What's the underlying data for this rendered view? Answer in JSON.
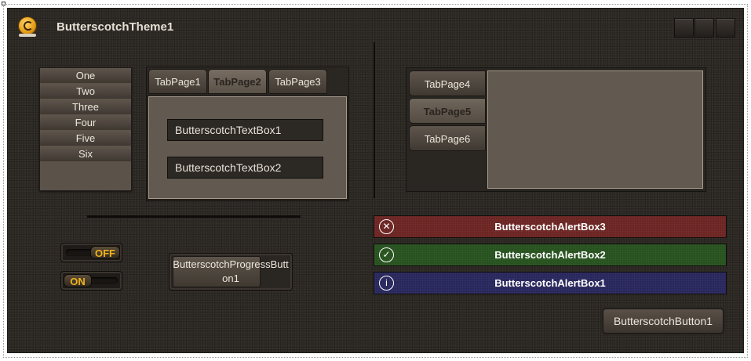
{
  "form": {
    "title": "ButterscotchTheme1"
  },
  "listbox": {
    "items": [
      "One",
      "Two",
      "Three",
      "Four",
      "Five",
      "Six"
    ]
  },
  "tabs1": {
    "tabs": [
      "TabPage1",
      "TabPage2",
      "TabPage3"
    ],
    "active": "TabPage2",
    "textboxes": [
      "ButterscotchTextBox1",
      "ButterscotchTextBox2"
    ]
  },
  "tabs2": {
    "tabs": [
      "TabPage4",
      "TabPage5",
      "TabPage6"
    ],
    "active": "TabPage5"
  },
  "toggles": {
    "off_label": "OFF",
    "on_label": "ON"
  },
  "progress_button": {
    "label": "ButterscotchProgressButton1"
  },
  "alerts": [
    {
      "label": "ButterscotchAlertBox3",
      "icon": "x-circle-icon",
      "color": "#6b2523"
    },
    {
      "label": "ButterscotchAlertBox2",
      "icon": "check-circle-icon",
      "color": "#27521f"
    },
    {
      "label": "ButterscotchAlertBox1",
      "icon": "info-circle-icon",
      "color": "#28275c"
    }
  ],
  "button": {
    "label": "ButterscotchButton1"
  },
  "colors": {
    "accent": "#f2b21b",
    "background": "#2f2b26"
  }
}
